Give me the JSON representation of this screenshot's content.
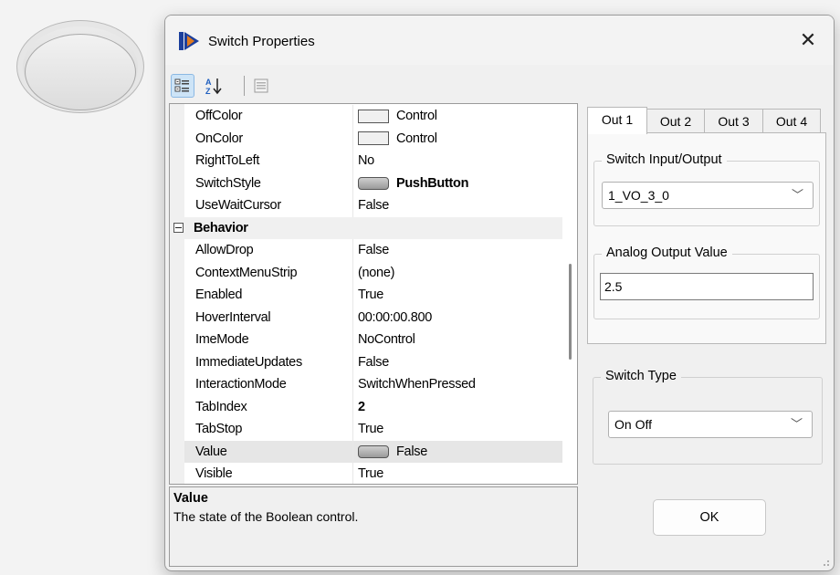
{
  "dialog": {
    "title": "Switch Properties",
    "close_label": "✕"
  },
  "toolbar": {
    "categorized_icon": "categorized-icon",
    "alphabetical_icon": "sort-az-icon",
    "pages_icon": "property-pages-icon"
  },
  "grid": {
    "rows": [
      {
        "name": "OffColor",
        "value": "Control",
        "kind": "swatch"
      },
      {
        "name": "OnColor",
        "value": "Control",
        "kind": "swatch"
      },
      {
        "name": "RightToLeft",
        "value": "No"
      },
      {
        "name": "SwitchStyle",
        "value": "PushButton",
        "kind": "button-bold"
      },
      {
        "name": "UseWaitCursor",
        "value": "False"
      },
      {
        "name": "Behavior",
        "kind": "category"
      },
      {
        "name": "AllowDrop",
        "value": "False"
      },
      {
        "name": "ContextMenuStrip",
        "value": "(none)"
      },
      {
        "name": "Enabled",
        "value": "True"
      },
      {
        "name": "HoverInterval",
        "value": "00:00:00.800"
      },
      {
        "name": "ImeMode",
        "value": "NoControl"
      },
      {
        "name": "ImmediateUpdates",
        "value": "False"
      },
      {
        "name": "InteractionMode",
        "value": "SwitchWhenPressed"
      },
      {
        "name": "TabIndex",
        "value": "2",
        "kind": "bold"
      },
      {
        "name": "TabStop",
        "value": "True"
      },
      {
        "name": "Value",
        "value": "False",
        "kind": "button",
        "selected": true
      },
      {
        "name": "Visible",
        "value": "True"
      }
    ]
  },
  "description": {
    "title": "Value",
    "text": "The state of the Boolean control."
  },
  "tabs": [
    "Out 1",
    "Out 2",
    "Out 3",
    "Out 4"
  ],
  "out1": {
    "io_group_label": "Switch Input/Output",
    "io_value": "1_VO_3_0",
    "analog_group_label": "Analog Output Value",
    "analog_value": "2.5"
  },
  "switch_type": {
    "group_label": "Switch Type",
    "value": "On Off"
  },
  "ok_label": "OK"
}
